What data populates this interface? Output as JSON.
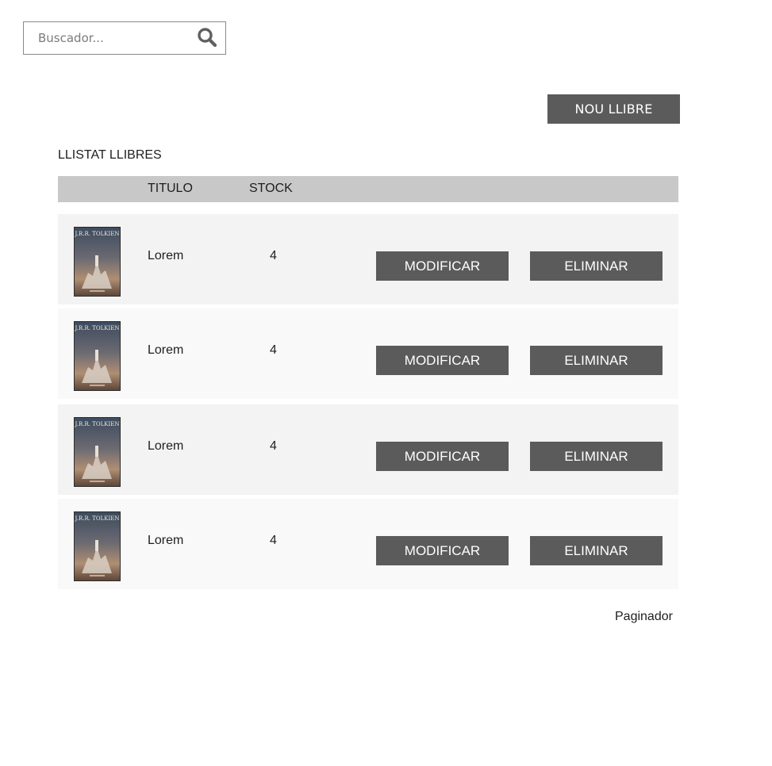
{
  "search": {
    "placeholder": "Buscador..."
  },
  "toolbar": {
    "new_book_label": "NOU LLIBRE"
  },
  "list": {
    "title": "LLISTAT LLIBRES",
    "columns": {
      "title": "TITULO",
      "stock": "STOCK"
    },
    "rows": [
      {
        "cover_author": "J.R.R. TOLKIEN",
        "title": "Lorem",
        "stock": "4",
        "modify_label": "MODIFICAR",
        "delete_label": "ELIMINAR"
      },
      {
        "cover_author": "J.R.R. TOLKIEN",
        "title": "Lorem",
        "stock": "4",
        "modify_label": "MODIFICAR",
        "delete_label": "ELIMINAR"
      },
      {
        "cover_author": "J.R.R. TOLKIEN",
        "title": "Lorem",
        "stock": "4",
        "modify_label": "MODIFICAR",
        "delete_label": "ELIMINAR"
      },
      {
        "cover_author": "J.R.R. TOLKIEN",
        "title": "Lorem",
        "stock": "4",
        "modify_label": "MODIFICAR",
        "delete_label": "ELIMINAR"
      }
    ]
  },
  "footer": {
    "paginator_label": "Paginador"
  },
  "colors": {
    "button_bg": "#5b5b5b",
    "header_bg": "#c8c8c8",
    "row_odd_bg": "#f3f3f3",
    "row_even_bg": "#f9f9f9"
  },
  "icons": {
    "search": "search-icon"
  }
}
